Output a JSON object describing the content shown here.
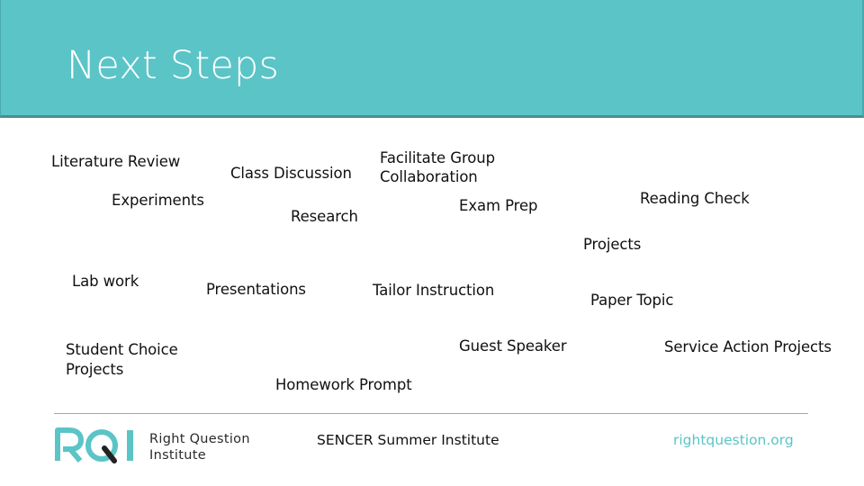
{
  "slide": {
    "title": "Next Steps",
    "header_color": "#5bc4c7"
  },
  "items": [
    {
      "label": "Literature Review"
    },
    {
      "label": "Class Discussion"
    },
    {
      "label": "Facilitate Group",
      "label2": "Collaboration"
    },
    {
      "label": "Experiments"
    },
    {
      "label": "Research"
    },
    {
      "label": "Exam Prep"
    },
    {
      "label": "Reading Check"
    },
    {
      "label": "Projects"
    },
    {
      "label": "Lab work"
    },
    {
      "label": "Presentations"
    },
    {
      "label": "Tailor Instruction"
    },
    {
      "label": "Paper Topic"
    },
    {
      "label": "Student Choice",
      "label2": "Projects"
    },
    {
      "label": "Guest Speaker"
    },
    {
      "label": "Service Action Projects"
    },
    {
      "label": "Homework Prompt"
    }
  ],
  "footer": {
    "logo_mark": "RQI",
    "logo_line1": "Right Question",
    "logo_line2": "Institute",
    "center_text": "SENCER Summer Institute",
    "website": "rightquestion.org",
    "brand_color": "#5bc4c7"
  }
}
